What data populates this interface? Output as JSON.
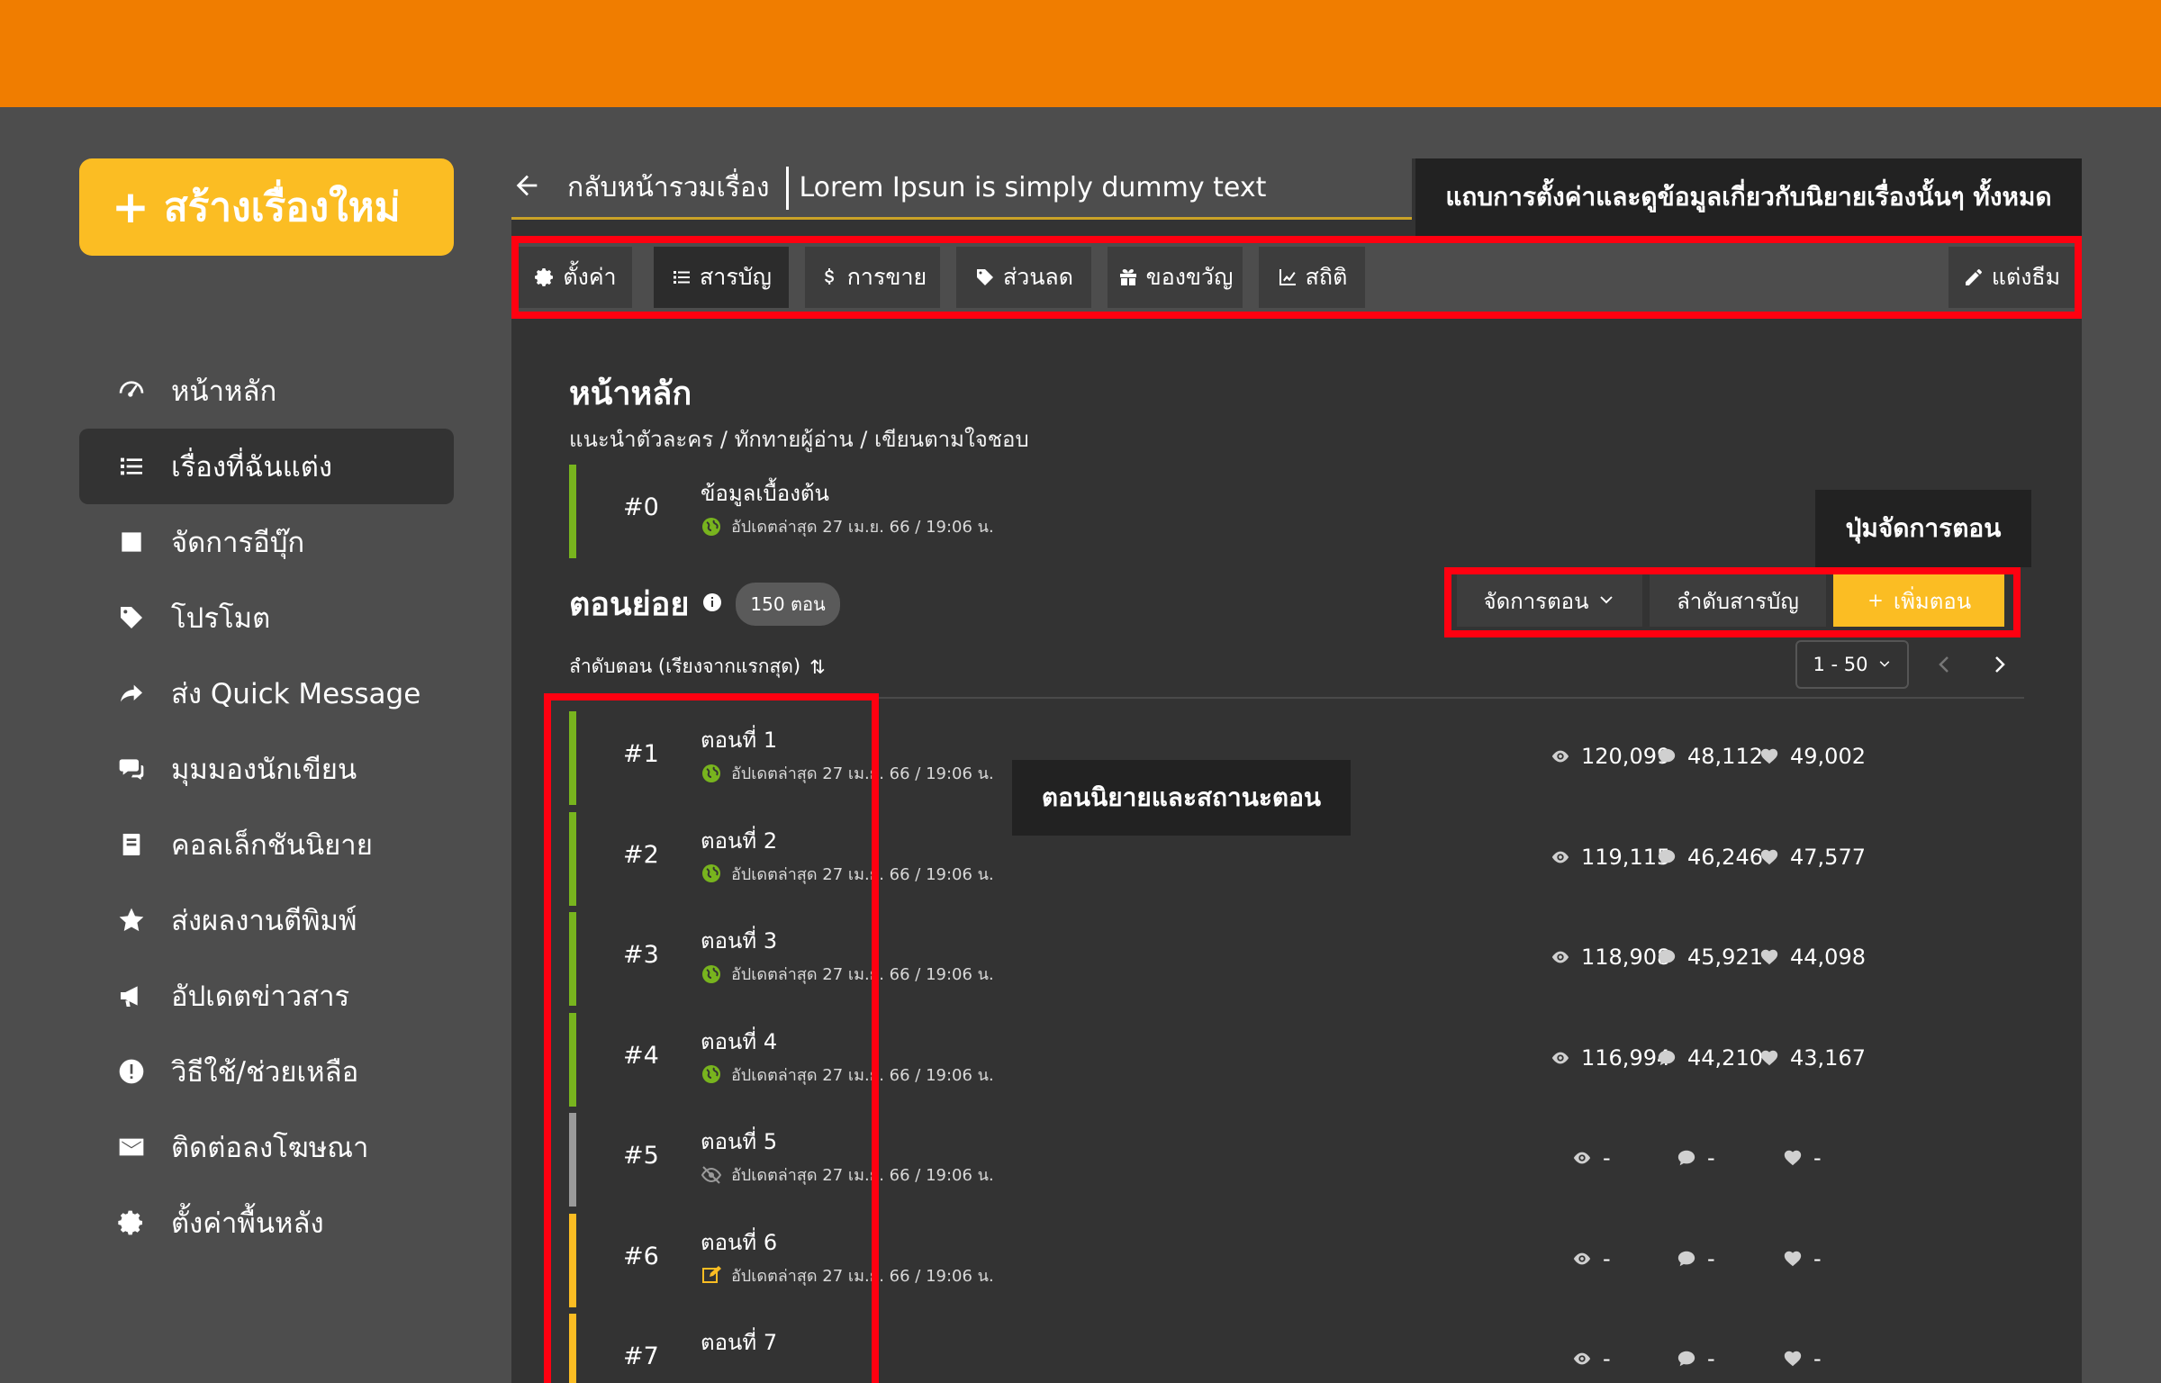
{
  "colors": {
    "topbar": "#f07d00",
    "accent": "#fbbd23",
    "published": "#78b41e",
    "hidden": "#9a9a9a",
    "draft": "#fbbd23",
    "annotation_border": "#ff0010"
  },
  "sidebar": {
    "create_label": "สร้างเรื่องใหม่",
    "items": [
      {
        "label": "หน้าหลัก",
        "icon": "dashboard-icon"
      },
      {
        "label": "เรื่องที่ฉันแต่ง",
        "icon": "list-icon"
      },
      {
        "label": "จัดการอีบุ๊ก",
        "icon": "ebook-icon"
      },
      {
        "label": "โปรโมต",
        "icon": "tag-icon"
      },
      {
        "label": "ส่ง Quick Message",
        "icon": "share-icon"
      },
      {
        "label": "มุมมองนักเขียน",
        "icon": "comments-icon"
      },
      {
        "label": "คอลเล็กชันนิยาย",
        "icon": "book-icon"
      },
      {
        "label": "ส่งผลงานตีพิมพ์",
        "icon": "star-icon"
      },
      {
        "label": "อัปเดตข่าวสาร",
        "icon": "megaphone-icon"
      },
      {
        "label": "วิธีใช้/ช่วยเหลือ",
        "icon": "exclamation-icon"
      },
      {
        "label": "ติดต่อลงโฆษณา",
        "icon": "mail-icon"
      },
      {
        "label": "ตั้งค่าพื้นหลัง",
        "icon": "gear-icon"
      }
    ],
    "active_index": 1
  },
  "header": {
    "back_label": "กลับหน้ารวมเรื่อง",
    "story_title": "Lorem Ipsun is simply dummy text"
  },
  "annotations": {
    "tabbar": "แถบการตั้งค่าและดูข้อมูลเกี่ยวกับนิยายเรื่องนั้นๆ ทั้งหมด",
    "buttons": "ปุ่มจัดการตอน",
    "episodes": "ตอนนิยายและสถานะตอน"
  },
  "tabs": [
    {
      "label": "ตั้งค่า",
      "icon": "gear-icon"
    },
    {
      "label": "สารบัญ",
      "icon": "list-icon"
    },
    {
      "label": "การขาย",
      "icon": "dollar-icon"
    },
    {
      "label": "ส่วนลด",
      "icon": "tag-icon"
    },
    {
      "label": "ของขวัญ",
      "icon": "gift-icon"
    },
    {
      "label": "สถิติ",
      "icon": "chart-icon"
    }
  ],
  "theme_label": "แต่งธีม",
  "main": {
    "title": "หน้าหลัก",
    "subtitle": "แนะนำตัวละคร / ทักทายผู้อ่าน / เขียนตามใจชอบ",
    "intro": {
      "num": "#0",
      "name": "ข้อมูลเบื้องต้น",
      "meta": "อัปเดตล่าสุด 27 เม.ย. 66 / 19:06 น."
    },
    "episodes_title": "ตอนย่อย",
    "episode_count": "150 ตอน",
    "manage_label": "จัดการตอน",
    "order_label": "ลำดับสารบัญ",
    "add_label": "เพิ่มตอน",
    "sort_label": "ลำดับตอน (เรียงจากแรกสุด)",
    "page_range": "1 - 50"
  },
  "episodes": [
    {
      "num": "#1",
      "name": "ตอนที่ 1",
      "meta": "อัปเดตล่าสุด 27 เม.ย. 66 / 19:06 น.",
      "status": "published",
      "views": "120,099",
      "comments": "48,112",
      "likes": "49,002"
    },
    {
      "num": "#2",
      "name": "ตอนที่ 2",
      "meta": "อัปเดตล่าสุด 27 เม.ย. 66 / 19:06 น.",
      "status": "published",
      "views": "119,115",
      "comments": "46,246",
      "likes": "47,577"
    },
    {
      "num": "#3",
      "name": "ตอนที่ 3",
      "meta": "อัปเดตล่าสุด 27 เม.ย. 66 / 19:06 น.",
      "status": "published",
      "views": "118,908",
      "comments": "45,921",
      "likes": "44,098"
    },
    {
      "num": "#4",
      "name": "ตอนที่ 4",
      "meta": "อัปเดตล่าสุด 27 เม.ย. 66 / 19:06 น.",
      "status": "published",
      "views": "116,994",
      "comments": "44,210",
      "likes": "43,167"
    },
    {
      "num": "#5",
      "name": "ตอนที่ 5",
      "meta": "อัปเดตล่าสุด 27 เม.ย. 66 / 19:06 น.",
      "status": "hidden",
      "views": "-",
      "comments": "-",
      "likes": "-"
    },
    {
      "num": "#6",
      "name": "ตอนที่ 6",
      "meta": "อัปเดตล่าสุด 27 เม.ย. 66 / 19:06 น.",
      "status": "draft",
      "views": "-",
      "comments": "-",
      "likes": "-"
    },
    {
      "num": "#7",
      "name": "ตอนที่ 7",
      "meta": "",
      "status": "draft",
      "views": "-",
      "comments": "-",
      "likes": "-"
    }
  ]
}
